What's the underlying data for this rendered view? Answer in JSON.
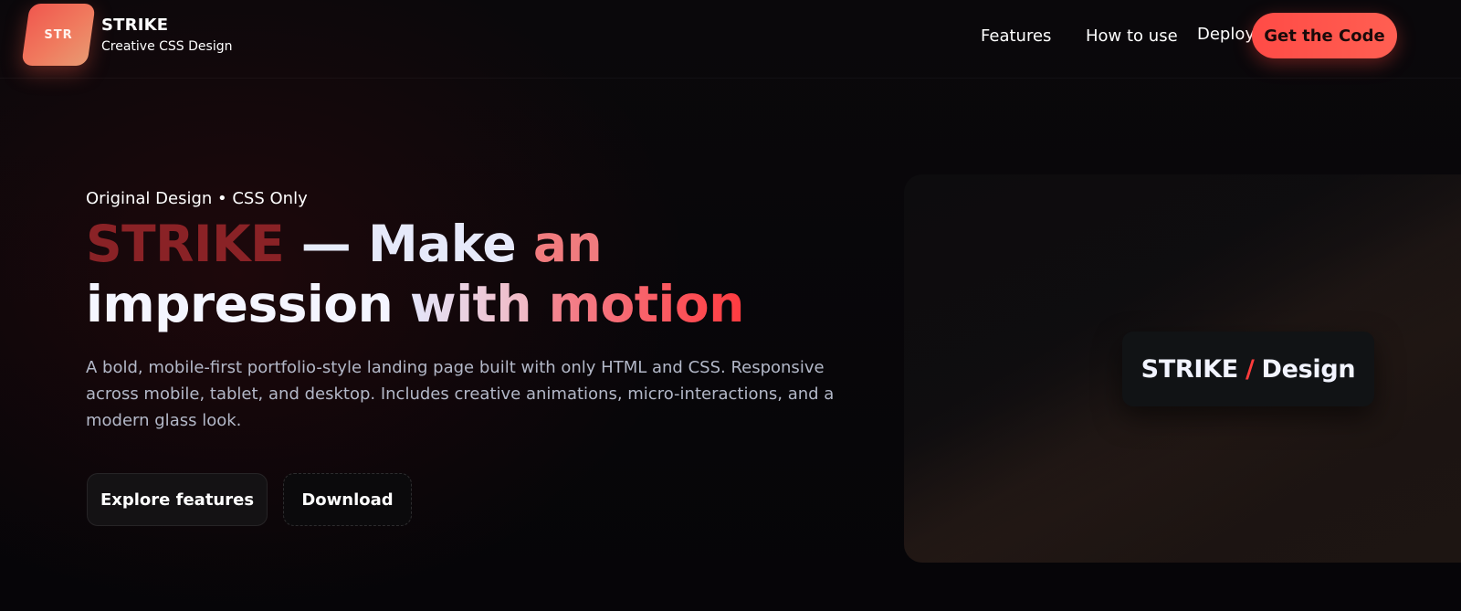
{
  "header": {
    "logo_mark": "STR",
    "brand_name": "STRIKE",
    "brand_tagline": "Creative CSS Design",
    "nav": {
      "features": "Features",
      "how_to_use": "How to use",
      "deploy": "Deploy"
    },
    "cta_label": "Get the Code"
  },
  "hero": {
    "eyebrow": "Original Design • CSS Only",
    "headline": {
      "strike": "STRIKE",
      "dash": "—",
      "make": "Make",
      "an": "an",
      "impression": "impression",
      "with": "with",
      "motion": "motion"
    },
    "description": "A bold, mobile-first portfolio-style landing page built with only HTML and CSS. Responsive across mobile, tablet, and desktop. Includes creative animations, micro-interactions, and a modern glass look.",
    "buttons": {
      "explore": "Explore features",
      "download": "Download"
    }
  },
  "showcase": {
    "badge_left": "STRIKE",
    "badge_slash": "/",
    "badge_right": "Design"
  },
  "colors": {
    "accent": "#ff4b46",
    "strike_dark": "#8a2226",
    "background": "#07060a"
  }
}
